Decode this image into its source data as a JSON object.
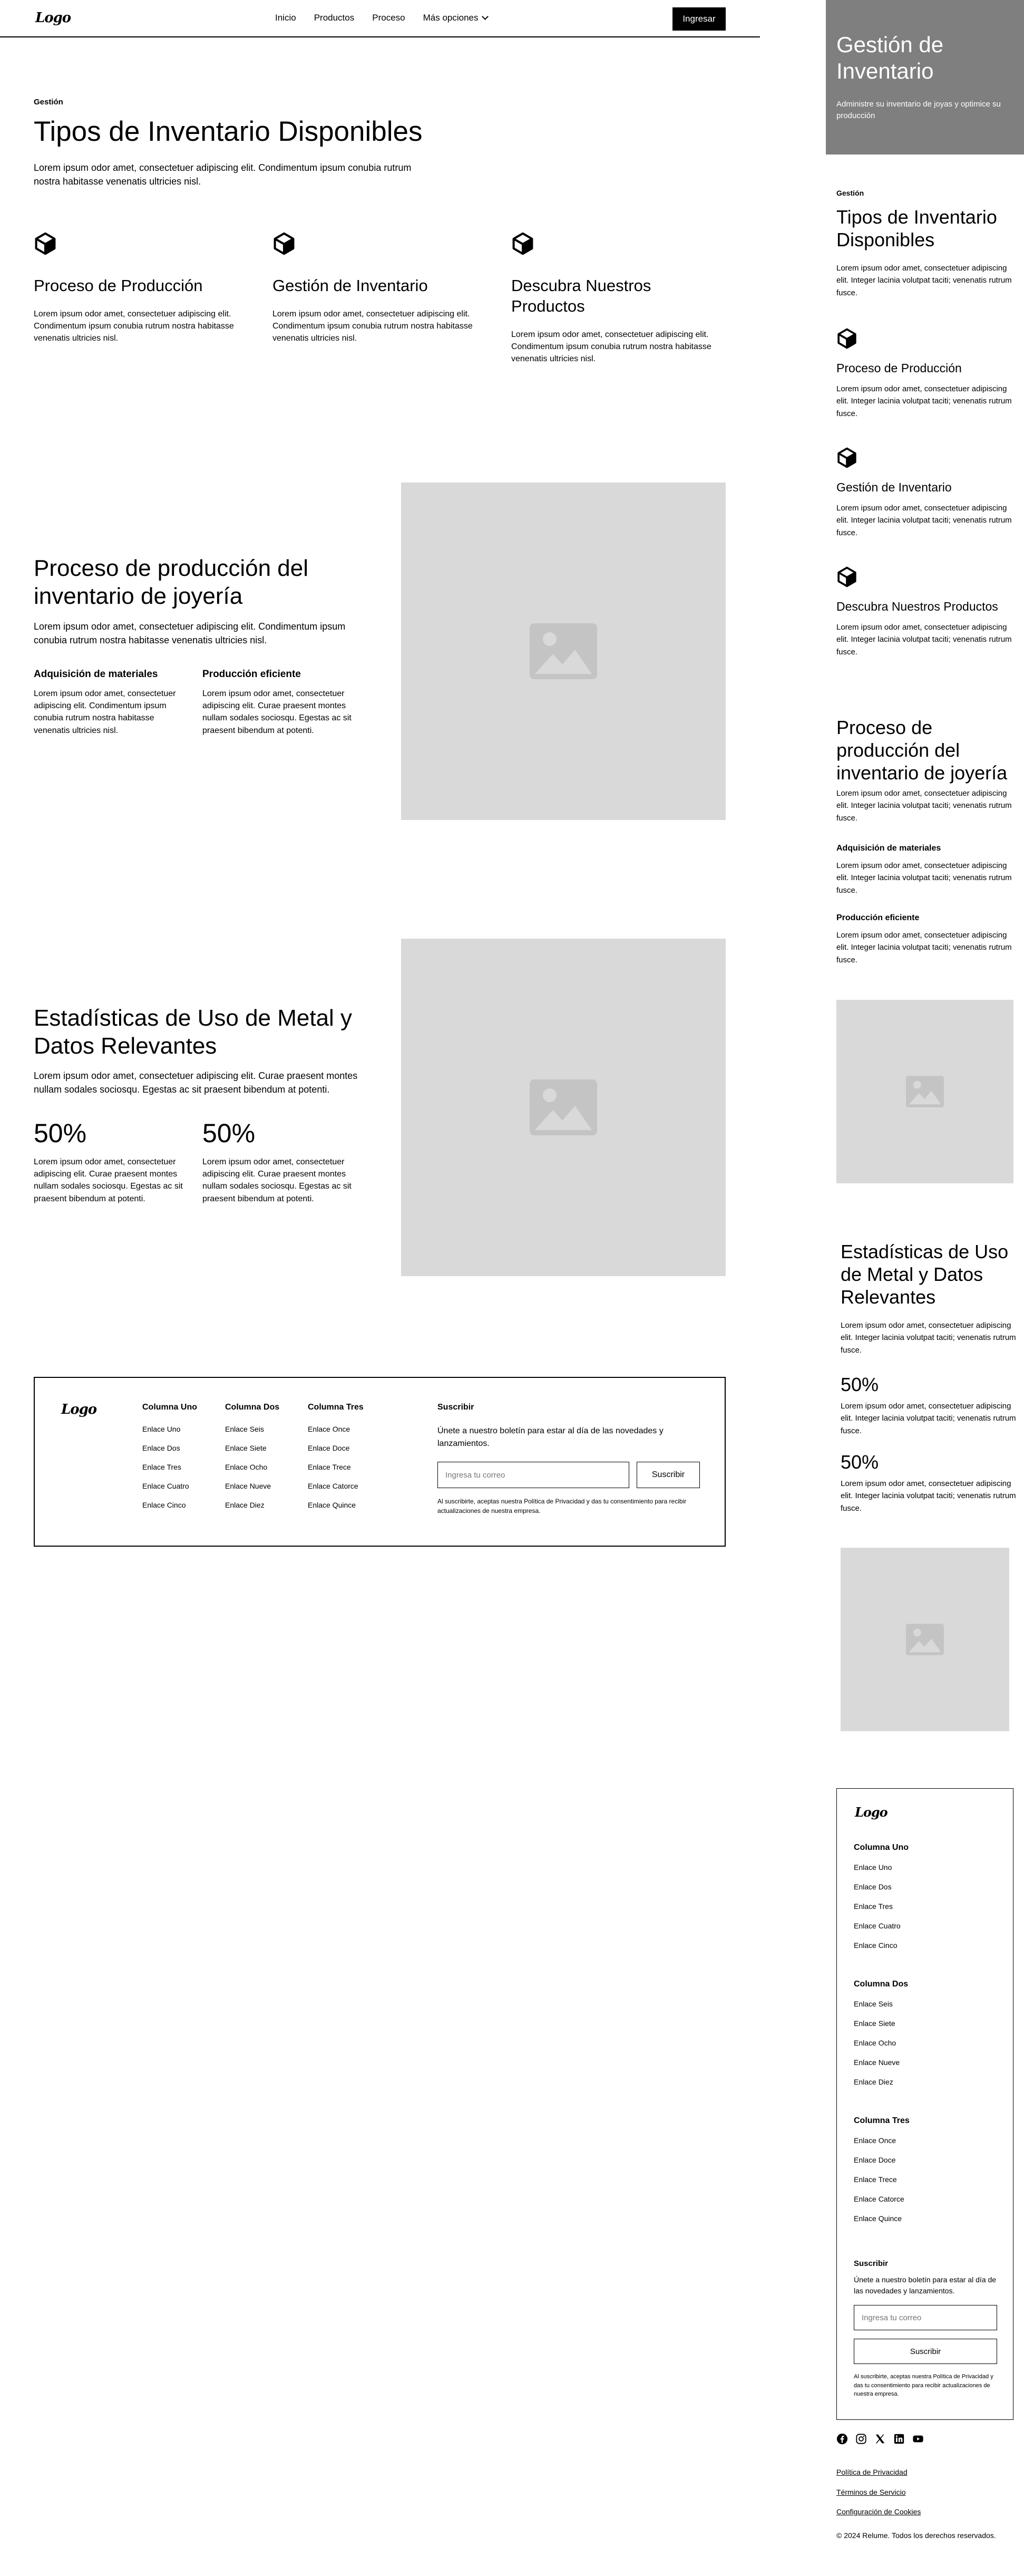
{
  "nav": {
    "logo": "Logo",
    "links": [
      "Inicio",
      "Productos",
      "Proceso",
      "Más opciones"
    ],
    "cta": "Ingresar"
  },
  "hero": {
    "title": "Gestión de Inventario",
    "subtitle": "Administre su inventario de joyas y optimice su producción"
  },
  "types": {
    "tagline": "Gestión",
    "title": "Tipos de Inventario Disponibles",
    "lead": "Lorem ipsum odor amet, consectetuer adipiscing elit. Condimentum ipsum conubia rutrum nostra habitasse venenatis ultricies nisl.",
    "features": [
      {
        "icon": "cube-icon",
        "title": "Proceso de Producción",
        "text": "Lorem ipsum odor amet, consectetuer adipiscing elit. Condimentum ipsum conubia rutrum nostra habitasse venenatis ultricies nisl."
      },
      {
        "icon": "cube-icon",
        "title": "Gestión de Inventario",
        "text": "Lorem ipsum odor amet, consectetuer adipiscing elit. Condimentum ipsum conubia rutrum nostra habitasse venenatis ultricies nisl."
      },
      {
        "icon": "cube-icon",
        "title": "Descubra Nuestros Productos",
        "text": "Lorem ipsum odor amet, consectetuer adipiscing elit. Condimentum ipsum conubia rutrum nostra habitasse venenatis ultricies nisl."
      }
    ]
  },
  "production": {
    "title": "Proceso de producción del inventario de joyería",
    "lead": "Lorem ipsum odor amet, consectetuer adipiscing elit. Condimentum ipsum conubia rutrum nostra habitasse venenatis ultricies nisl.",
    "items": [
      {
        "title": "Adquisición de materiales",
        "text": "Lorem ipsum odor amet, consectetuer adipiscing elit. Condimentum ipsum conubia rutrum nostra habitasse venenatis ultricies nisl."
      },
      {
        "title": "Producción eficiente",
        "text": "Lorem ipsum odor amet, consectetuer adipiscing elit. Curae praesent montes nullam sodales sociosqu. Egestas ac sit praesent bibendum at potenti."
      }
    ]
  },
  "stats": {
    "title": "Estadísticas de Uso de Metal y Datos Relevantes",
    "lead": "Lorem ipsum odor amet, consectetuer adipiscing elit. Curae praesent montes nullam sodales sociosqu. Egestas ac sit praesent bibendum at potenti.",
    "items": [
      {
        "value": "50%",
        "text": "Lorem ipsum odor amet, consectetuer adipiscing elit. Curae praesent montes nullam sodales sociosqu. Egestas ac sit praesent bibendum at potenti."
      },
      {
        "value": "50%",
        "text": "Lorem ipsum odor amet, consectetuer adipiscing elit. Curae praesent montes nullam sodales sociosqu. Egestas ac sit praesent bibendum at potenti."
      }
    ]
  },
  "footer": {
    "logo": "Logo",
    "columns": [
      {
        "title": "Columna Uno",
        "links": [
          "Enlace Uno",
          "Enlace Dos",
          "Enlace Tres",
          "Enlace Cuatro",
          "Enlace Cinco"
        ]
      },
      {
        "title": "Columna Dos",
        "links": [
          "Enlace Seis",
          "Enlace Siete",
          "Enlace Ocho",
          "Enlace Nueve",
          "Enlace Diez"
        ]
      },
      {
        "title": "Columna Tres",
        "links": [
          "Enlace Once",
          "Enlace Doce",
          "Enlace Trece",
          "Enlace Catorce",
          "Enlace Quince"
        ]
      }
    ],
    "subscribe": {
      "title": "Suscribir",
      "text": "Únete a nuestro boletín para estar al día de las novedades y lanzamientos.",
      "placeholder": "Ingresa tu correo",
      "button": "Suscribir",
      "fine": "Al suscribirte, aceptas nuestra Política de Privacidad y das tu consentimiento para recibir actualizaciones de nuestra empresa."
    }
  },
  "mobile": {
    "text": "Lorem ipsum odor amet, consectetuer adipiscing elit. Integer lacinia volutpat taciti; venenatis rutrum fusce.",
    "legal": [
      "Política de Privacidad",
      "Términos de Servicio",
      "Configuración de Cookies"
    ],
    "copyright": "© 2024 Relume. Todos los derechos reservados.",
    "socials": [
      "facebook-icon",
      "instagram-icon",
      "x-icon",
      "linkedin-icon",
      "youtube-icon"
    ]
  }
}
